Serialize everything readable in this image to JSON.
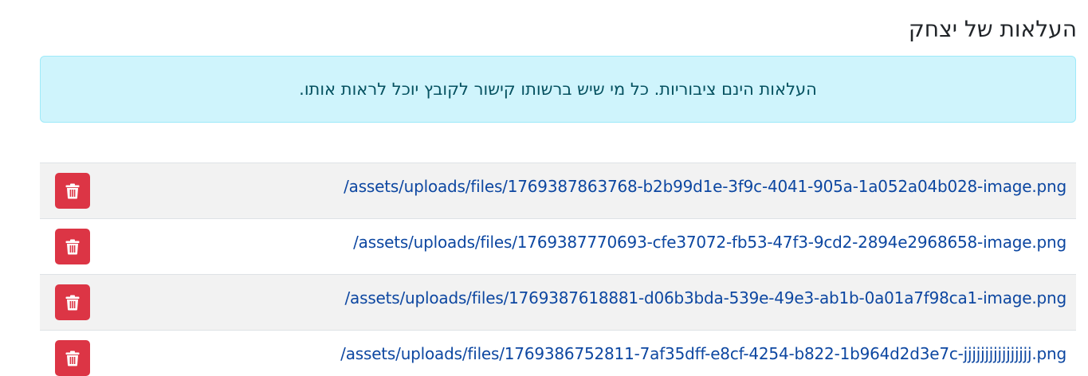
{
  "header": {
    "title": "העלאות של יצחק"
  },
  "notice": {
    "text": "העלאות הינם ציבוריות. כל מי שיש ברשותו קישור לקובץ יוכל לראות אותו."
  },
  "files": [
    {
      "path": "/assets/uploads/files/1769387863768-b2b99d1e-3f9c-4041-905a-1a052a04b028-image.png"
    },
    {
      "path": "/assets/uploads/files/1769387770693-cfe37072-fb53-47f3-9cd2-2894e2968658-image.png"
    },
    {
      "path": "/assets/uploads/files/1769387618881-d06b3bda-539e-49e3-ab1b-0a01a7f98ca1-image.png"
    },
    {
      "path": "/assets/uploads/files/1769386752811-7af35dff-e8cf-4254-b822-1b964d2d3e7c-jjjjjjjjjjjjjjjj.png"
    }
  ],
  "icons": {
    "delete": "trash-icon"
  },
  "colors": {
    "danger": "#dc3545",
    "info_bg": "#cff4fc",
    "link": "#0d47a1"
  }
}
